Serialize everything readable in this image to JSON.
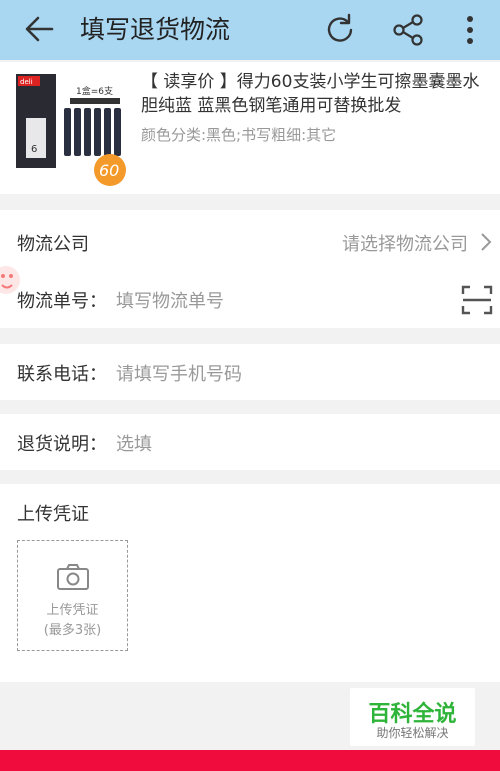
{
  "header": {
    "title": "填写退货物流",
    "icons": [
      "back-arrow-icon",
      "refresh-icon",
      "share-icon",
      "more-vert-icon"
    ]
  },
  "product": {
    "title": "【 读享价 】得力60支装小学生可擦墨囊墨水胆纯蓝 蓝黑色钢笔通用可替换批发",
    "attrs": "颜色分类:黑色;书写粗细:其它",
    "image_text": {
      "brand": "deli",
      "box_label": "1盒=6支",
      "count": "6",
      "badge": "60"
    }
  },
  "form": {
    "logistics_company": {
      "label": "物流公司",
      "placeholder": "请选择物流公司"
    },
    "tracking_number": {
      "label": "物流单号：",
      "placeholder": "填写物流单号"
    },
    "phone": {
      "label": "联系电话：",
      "placeholder": "请填写手机号码"
    },
    "note": {
      "label": "退货说明：",
      "placeholder": "选填"
    }
  },
  "upload": {
    "section_title": "上传凭证",
    "button_line1": "上传凭证",
    "button_line2": "(最多3张)"
  },
  "watermark": {
    "line1": "百科全说",
    "line2": "助你轻松解决"
  },
  "colors": {
    "header_bg": "#a9d7f2",
    "bottom_bar": "#f00c3c",
    "watermark_green": "#2fb43a"
  }
}
